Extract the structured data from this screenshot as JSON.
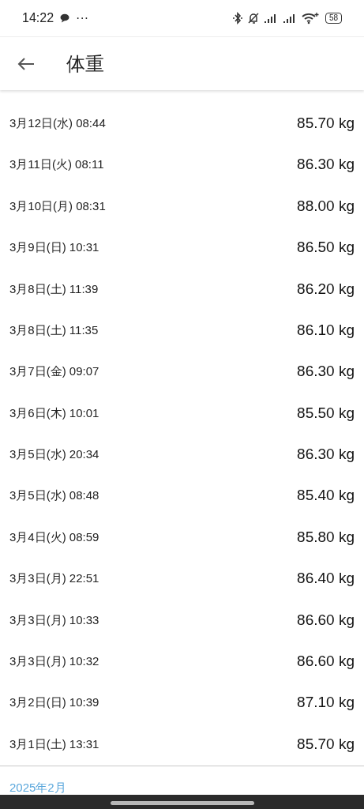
{
  "status_bar": {
    "time": "14:22",
    "notification": "···",
    "battery": "58"
  },
  "app_bar": {
    "title": "体重"
  },
  "entries": [
    {
      "date": "3月12日(水) 08:44",
      "weight": "85.70 kg"
    },
    {
      "date": "3月11日(火) 08:11",
      "weight": "86.30 kg"
    },
    {
      "date": "3月10日(月) 08:31",
      "weight": "88.00 kg"
    },
    {
      "date": "3月9日(日) 10:31",
      "weight": "86.50 kg"
    },
    {
      "date": "3月8日(土) 11:39",
      "weight": "86.20 kg"
    },
    {
      "date": "3月8日(土) 11:35",
      "weight": "86.10 kg"
    },
    {
      "date": "3月7日(金) 09:07",
      "weight": "86.30 kg"
    },
    {
      "date": "3月6日(木) 10:01",
      "weight": "85.50 kg"
    },
    {
      "date": "3月5日(水) 20:34",
      "weight": "86.30 kg"
    },
    {
      "date": "3月5日(水) 08:48",
      "weight": "85.40 kg"
    },
    {
      "date": "3月4日(火) 08:59",
      "weight": "85.80 kg"
    },
    {
      "date": "3月3日(月) 22:51",
      "weight": "86.40 kg"
    },
    {
      "date": "3月3日(月) 10:33",
      "weight": "86.60 kg"
    },
    {
      "date": "3月3日(月) 10:32",
      "weight": "86.60 kg"
    },
    {
      "date": "3月2日(日) 10:39",
      "weight": "87.10 kg"
    },
    {
      "date": "3月1日(土) 13:31",
      "weight": "85.70 kg"
    }
  ],
  "next_section": {
    "header": "2025年2月"
  }
}
